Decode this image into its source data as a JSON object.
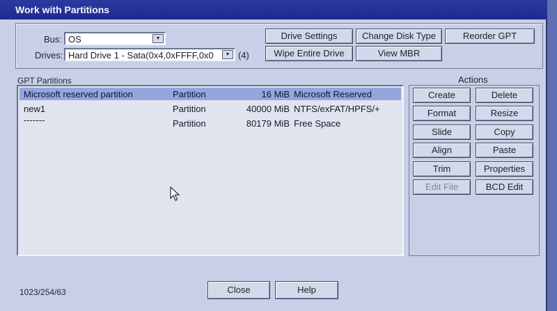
{
  "window": {
    "title": "Work with Partitions"
  },
  "bus": {
    "label": "Bus:",
    "value": "OS"
  },
  "drives": {
    "label": "Drives:",
    "value": "Hard Drive 1 - Sata(0x4,0xFFFF,0x0",
    "count": "(4)"
  },
  "top_buttons": {
    "drive_settings": "Drive Settings",
    "change_disk_type": "Change Disk Type",
    "reorder_gpt": "Reorder GPT",
    "wipe_entire_drive": "Wipe Entire Drive",
    "view_mbr": "View MBR"
  },
  "partitions": {
    "title": "GPT Partitions",
    "rows": [
      {
        "name": "Microsoft reserved partition",
        "type": "Partition",
        "size": "16 MiB",
        "fs": "Microsoft Reserved",
        "selected": true
      },
      {
        "name": "new1",
        "type": "Partition",
        "size": "40000 MiB",
        "fs": "NTFS/exFAT/HPFS/+",
        "selected": false
      },
      {
        "name": "-------",
        "type": "Partition",
        "size": "80179 MiB",
        "fs": "Free Space",
        "selected": false
      }
    ]
  },
  "actions": {
    "title": "Actions",
    "create": "Create",
    "delete": "Delete",
    "format": "Format",
    "resize": "Resize",
    "slide": "Slide",
    "copy": "Copy",
    "align": "Align",
    "paste": "Paste",
    "trim": "Trim",
    "properties": "Properties",
    "edit_file": "Edit File",
    "bcd_edit": "BCD Edit"
  },
  "footer": {
    "geometry": "1023/254/63",
    "close": "Close",
    "help": "Help"
  },
  "colors": {
    "titlebar": "#1d2b8e",
    "panel": "#c7d0e6",
    "selection": "#93a6de"
  }
}
